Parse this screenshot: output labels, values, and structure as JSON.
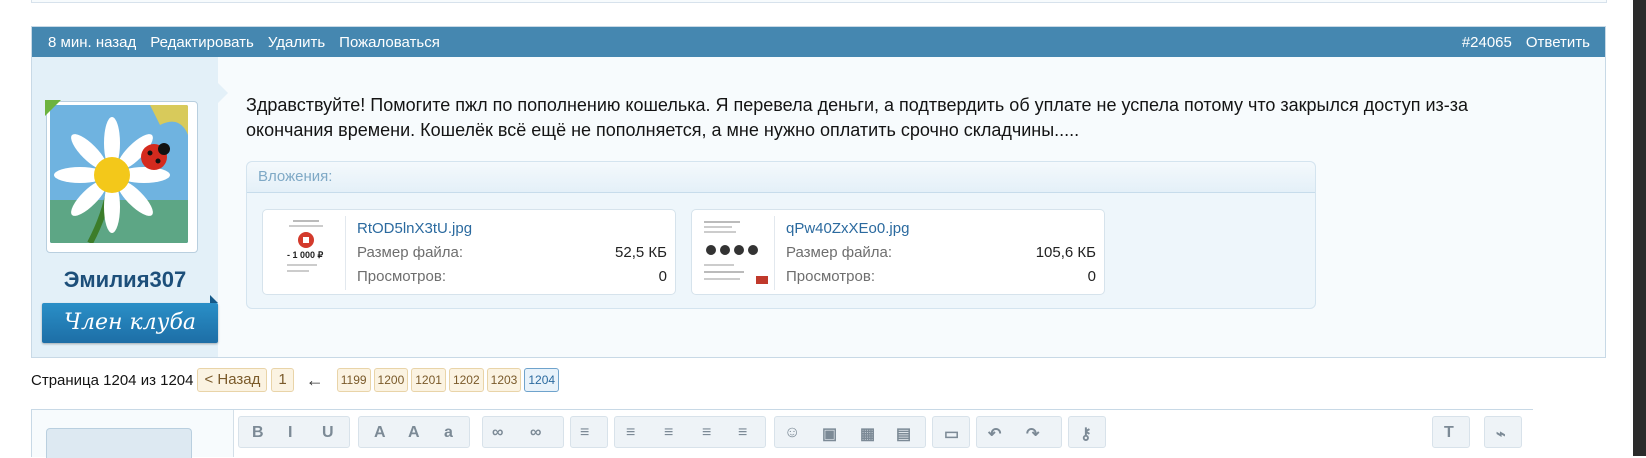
{
  "post": {
    "header_left": [
      "8 мин. назад",
      "Редактировать",
      "Удалить",
      "Пожаловаться"
    ],
    "post_number": "#24065",
    "reply_label": "Ответить",
    "username": "Эмилия307",
    "user_title": "Член клуба",
    "message": "Здравствуйте! Помогите пжл по пополнению кошелька. Я перевела деньги, а подтвердить об уплате не успела потому что закрылся доступ из-за окончания времени. Кошелёк всё ещё не пополняется, а мне нужно оплатить срочно складчины.....",
    "attachments_title": "Вложения:",
    "attachments": [
      {
        "file_name": "RtOD5lnX3tU.jpg",
        "size_label": "Размер файла:",
        "size_value": "52,5 КБ",
        "views_label": "Просмотров:",
        "views_value": "0",
        "thumb_text": "- 1 000 ₽"
      },
      {
        "file_name": "qPw40ZxXEo0.jpg",
        "size_label": "Размер файла:",
        "size_value": "105,6 КБ",
        "views_label": "Просмотров:",
        "views_value": "0"
      }
    ]
  },
  "pagination": {
    "label": "Страница 1204 из 1204",
    "prev": "< Назад",
    "first": "1",
    "ellipsis_arrow": "←",
    "pages": [
      "1199",
      "1200",
      "1201",
      "1202",
      "1203"
    ],
    "current": "1204"
  },
  "colors": {
    "header_bg": "#4587b0",
    "link": "#2b6a9f",
    "badge": "#1d6ea6"
  }
}
